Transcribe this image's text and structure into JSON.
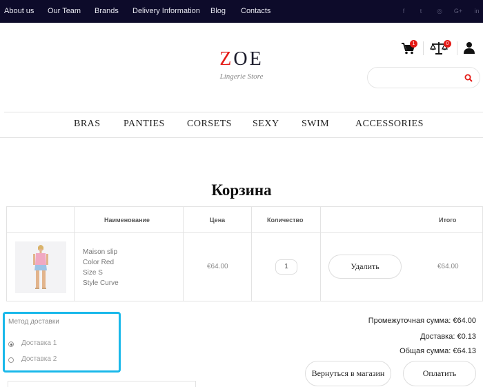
{
  "topbar": {
    "links": [
      "About us",
      "Our Team",
      "Brands",
      "Delivery Information",
      "Blog",
      "Contacts"
    ],
    "social": [
      {
        "name": "facebook-icon",
        "glyph": "f"
      },
      {
        "name": "twitter-icon",
        "glyph": "t"
      },
      {
        "name": "instagram-icon",
        "glyph": "◎"
      },
      {
        "name": "google-plus-icon",
        "glyph": "G+"
      },
      {
        "name": "linkedin-icon",
        "glyph": "in"
      }
    ]
  },
  "header": {
    "logo_first": "Z",
    "logo_rest": "OE",
    "tagline": "Lingerie Store",
    "cart_count": "1",
    "compare_count": "0",
    "search_placeholder": ""
  },
  "nav": [
    "BRAS",
    "PANTIES",
    "CORSETS",
    "SEXY",
    "SWIM",
    "ACCESSORIES"
  ],
  "page_title": "Корзина",
  "cart": {
    "headers": {
      "name": "Наименование",
      "price": "Цена",
      "qty": "Количество",
      "total": "Итого"
    },
    "items": [
      {
        "name": "Maison slip",
        "color": "Color Red",
        "size": "Size S",
        "style": "Style Curve",
        "price": "€64.00",
        "qty": "1",
        "delete_label": "Удалить",
        "total": "€64.00"
      }
    ]
  },
  "delivery": {
    "title": "Метод доставки",
    "options": [
      {
        "label": "Доставка 1",
        "selected": true
      },
      {
        "label": "Доставка 2",
        "selected": false
      }
    ]
  },
  "totals": {
    "subtotal": "Промежуточная сумма: €64.00",
    "shipping": "Доставка: €0.13",
    "grand": "Общая сумма: €64.13"
  },
  "actions": {
    "back_label": "Вернуться в магазин",
    "pay_label": "Оплатить"
  },
  "colors": {
    "accent": "#e41b17",
    "topbar": "#0d0b2a",
    "highlight": "#19b8ea"
  }
}
